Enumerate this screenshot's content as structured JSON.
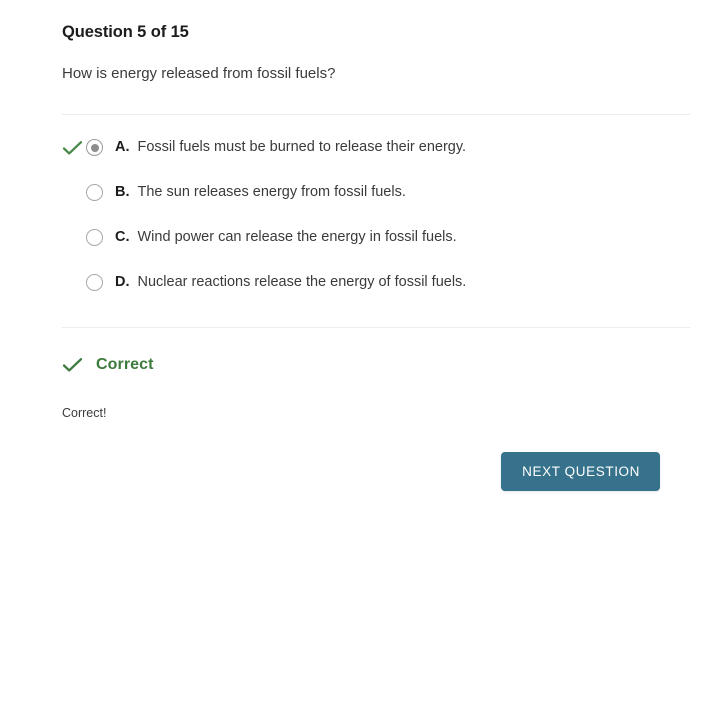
{
  "header": {
    "counter": "Question 5 of 15",
    "prompt": "How is energy released from fossil fuels?"
  },
  "options": [
    {
      "letter": "A.",
      "text": "Fossil fuels must be burned to release their energy.",
      "selected": true,
      "marked_correct": true
    },
    {
      "letter": "B.",
      "text": "The sun releases energy from fossil fuels.",
      "selected": false,
      "marked_correct": false
    },
    {
      "letter": "C.",
      "text": "Wind power can release the energy in fossil fuels.",
      "selected": false,
      "marked_correct": false
    },
    {
      "letter": "D.",
      "text": "Nuclear reactions release the energy of fossil fuels.",
      "selected": false,
      "marked_correct": false
    }
  ],
  "feedback": {
    "icon": "check-icon",
    "title": "Correct",
    "body": "Correct!"
  },
  "footer": {
    "next_label": "NEXT QUESTION"
  },
  "colors": {
    "correct_green": "#3d7a3d",
    "button_teal": "#36728b",
    "divider_gray": "#ededf0",
    "radio_gray": "#8c8c8c",
    "text_dark": "#3b3b3b",
    "heading_dark": "#1c1c1c"
  }
}
